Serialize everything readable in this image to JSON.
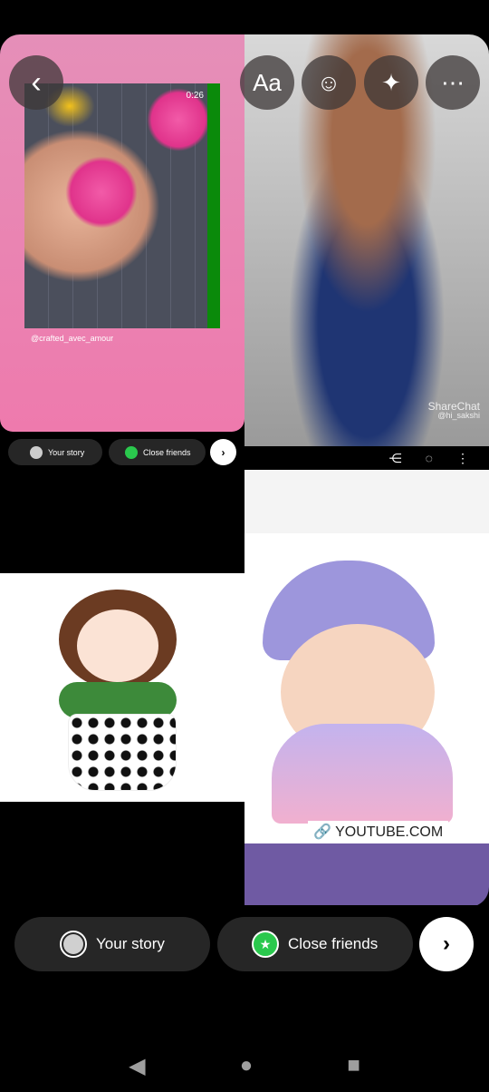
{
  "toolbar": {
    "back_icon": "chevron-left-icon",
    "text_label": "Aa",
    "sticker_icon": "sticker-icon",
    "effects_icon": "sparkles-icon",
    "more_icon": "more-horizontal-icon"
  },
  "collage": {
    "video": {
      "timer": "0:26",
      "handle": "@crafted_avec_amour"
    },
    "mini_share": {
      "your_story": "Your story",
      "close_friends": "Close friends"
    },
    "doll": {
      "watermark": "ShareChat",
      "watermark_handle": "@hi_sakshi"
    },
    "youtube_label": "YOUTUBE.COM"
  },
  "share_bar": {
    "your_story": "Your story",
    "close_friends": "Close friends",
    "accent": "#2ac84d"
  },
  "nav": {
    "back": "◀",
    "home": "●",
    "recents": "■"
  }
}
